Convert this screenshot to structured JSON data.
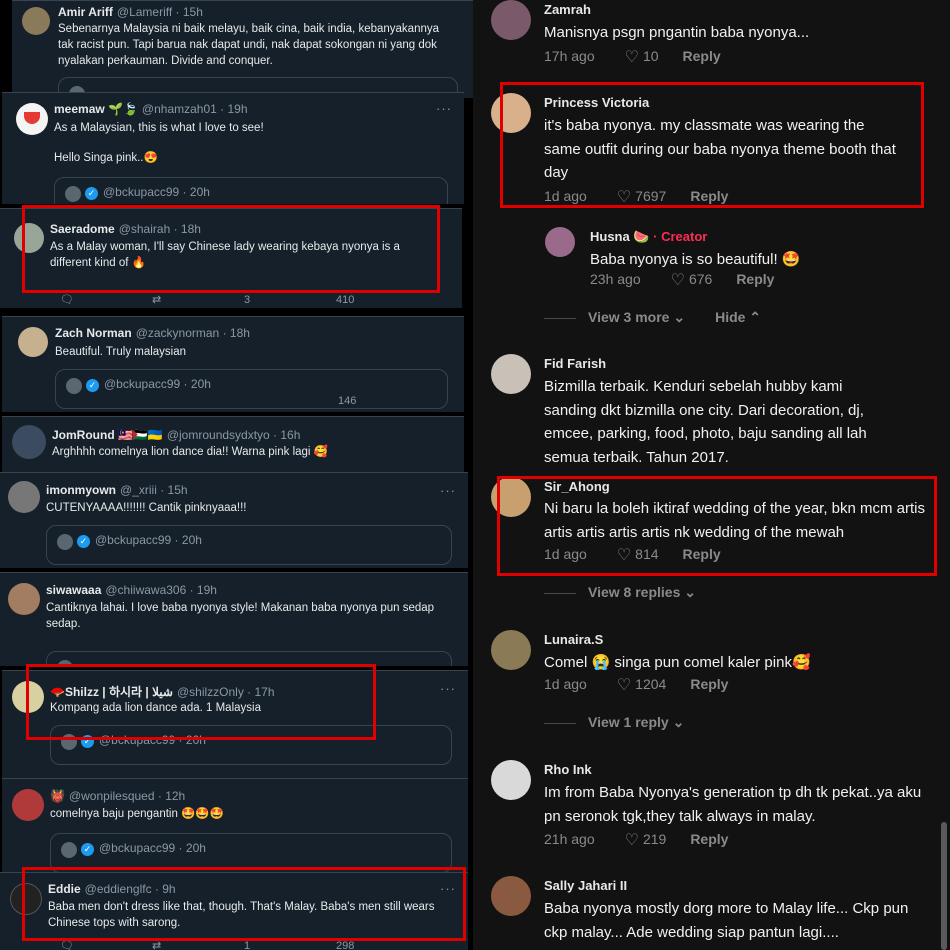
{
  "twitter": {
    "tweets": [
      {
        "name": "Amir Ariff",
        "handle": "@Lameriff · 15h",
        "text": "Sebenarnya Malaysia ni baik melayu, baik cina, baik india, kebanyakannya tak racist pun. Tapi barua nak dapat undi, nak dapat sokongan ni yang dok nyalakan perkauman. Divide and conquer."
      },
      {
        "name": "meemaw 🌱🍃",
        "handle": "@nhamzah01 · 19h",
        "text": "As a Malaysian, this is what I love to see!",
        "text2": "Hello Singa pink..😍"
      },
      {
        "name": "Saeradome",
        "handle": "@shairah · 18h",
        "text": "As a Malay woman, I'll say Chinese lady wearing kebaya nyonya is a different kind of 🔥"
      },
      {
        "name": "Zach Norman",
        "handle": "@zackynorman · 18h",
        "text": "Beautiful. Truly malaysian"
      },
      {
        "name": "JomRound 🇲🇾🇵🇸🇺🇦",
        "handle": "@jomroundsydxtyo · 16h",
        "text": "Arghhhh comelnya lion dance dia!! Warna pink lagi 🥰"
      },
      {
        "name": "imonmyown",
        "handle": "@_xriii · 15h",
        "text": "CUTENYAAAA!!!!!!! Cantik pinknyaaa!!!"
      },
      {
        "name": "siwawaaa",
        "handle": "@chiiwawa306 · 19h",
        "text": "Cantiknya lahai. I love baba nyonya style! Makanan baba nyonya pun sedap sedap."
      },
      {
        "name": "🪭Shilzz | 하시라 | شيلا",
        "handle": "@shilzzOnly · 17h",
        "text": "Kompang ada lion dance ada. 1 Malaysia"
      },
      {
        "name": "👹",
        "handle": "@wonpilesqued · 12h",
        "text": "comelnya baju pengantin 🤩🤩🤩"
      },
      {
        "name": "Eddie",
        "handle": "@eddienglfc · 9h",
        "text": "Baba men don't dress like that, though. That's Malay. Baba's men still wears Chinese tops with sarong."
      }
    ],
    "quote_handle": "@bckupacc99 · 20h",
    "quote_handle_partial": "@bckupacc99 · 20h",
    "stats_a": {
      "replies": "3",
      "views": "410"
    },
    "stats_b": {
      "views": "146"
    },
    "stats_c": {
      "replies": "1",
      "views": "298"
    }
  },
  "tiktok": {
    "comments": [
      {
        "user": "Zamrah",
        "text": "Manisnya psgn pngantin baba nyonya...",
        "age": "17h ago",
        "likes": "10",
        "reply": "Reply"
      },
      {
        "user": "Princess Victoria",
        "text": "it's baba nyonya. my classmate was wearing the same outfit during our baba nyonya theme booth that day",
        "age": "1d ago",
        "likes": "7697",
        "reply": "Reply"
      },
      {
        "user": "Husna 🍉",
        "creator": "· Creator",
        "text": "Baba nyonya is so beautiful! 🤩",
        "age": "23h ago",
        "likes": "676",
        "reply": "Reply"
      },
      {
        "user": "Fid Farish",
        "text": "Bizmilla terbaik. Kenduri sebelah hubby kami sanding dkt bizmilla one city. Dari decoration, dj, emcee, parking, food, photo, baju sanding all lah semua terbaik. Tahun 2017."
      },
      {
        "user": "Sir_Ahong",
        "text": "Ni baru la boleh iktiraf wedding of the year, bkn mcm artis artis artis artis artis nk wedding of the mewah",
        "age": "1d ago",
        "likes": "814",
        "reply": "Reply"
      },
      {
        "user": "Lunaira.S",
        "text": "Comel 😭 singa pun comel kaler pink🥰",
        "age": "1d ago",
        "likes": "1204",
        "reply": "Reply"
      },
      {
        "user": "Rho Ink",
        "text": "Im from Baba Nyonya's generation tp dh tk pekat..ya aku pn seronok tgk,they talk always in malay.",
        "age": "21h ago",
        "likes": "219",
        "reply": "Reply"
      },
      {
        "user": "Sally Jahari II",
        "text": "Baba nyonya mostly dorg more to Malay life... Ckp pun ckp malay... Ade wedding siap pantun lagi...."
      }
    ],
    "view_more_1": "View 3 more ⌄",
    "hide": "Hide ⌃",
    "view_replies_8": "View 8 replies ⌄",
    "view_reply_1": "View 1 reply ⌄"
  },
  "colors": {
    "highlight": "#e00000",
    "twitter_bg": "#15202b",
    "tiktok_bg": "#121212",
    "creator": "#fe2c55",
    "verified": "#1d9bf0"
  }
}
